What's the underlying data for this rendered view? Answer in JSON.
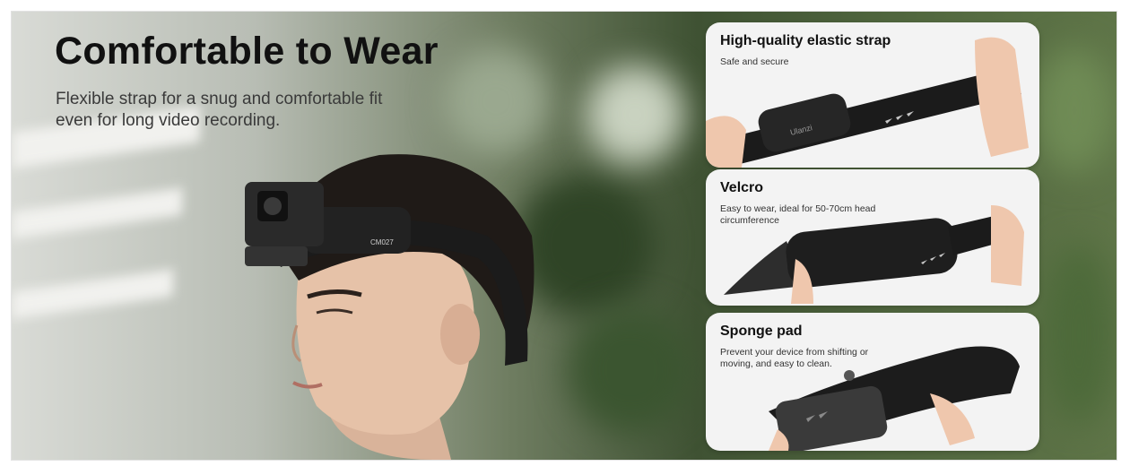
{
  "hero": {
    "headline": "Comfortable to Wear",
    "subline": "Flexible strap for a snug and comfortable fit even for long video recording.",
    "camera_label": "CM027"
  },
  "features": [
    {
      "title": "High-quality elastic strap",
      "description": "Safe and secure",
      "brand_text": "Ulanzi"
    },
    {
      "title": "Velcro",
      "description": "Easy to wear, ideal for 50-70cm head circumference"
    },
    {
      "title": "Sponge pad",
      "description": "Prevent your device from shifting or moving, and easy to clean."
    }
  ],
  "colors": {
    "headline": "#111111",
    "card_bg": "#f3f3f3",
    "strap": "#1b1b1b"
  }
}
